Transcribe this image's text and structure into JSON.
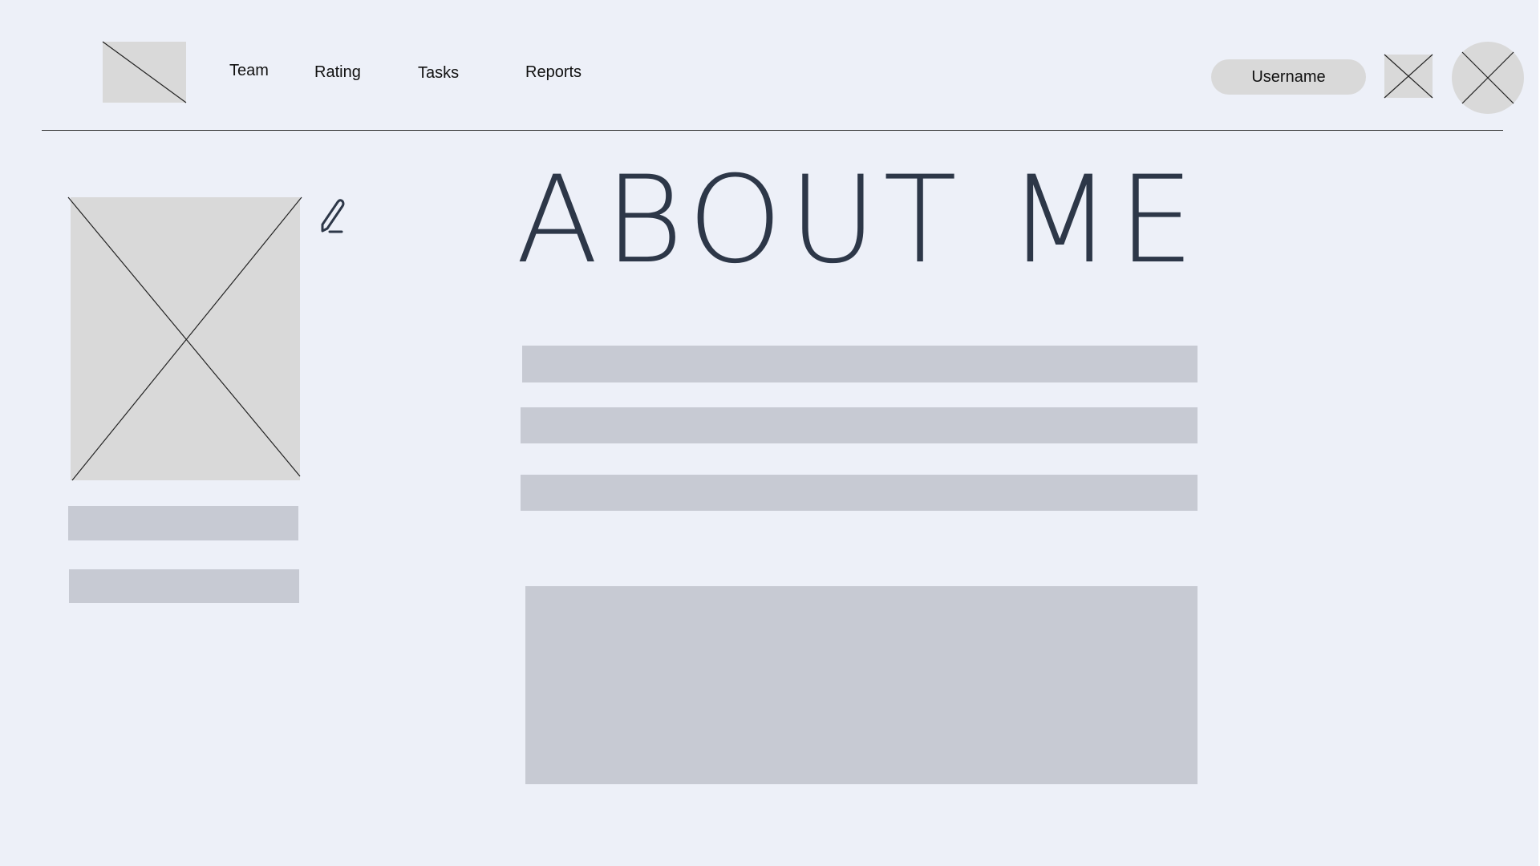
{
  "header": {
    "nav_items": [
      {
        "label": "Team"
      },
      {
        "label": "Rating"
      },
      {
        "label": "Tasks"
      },
      {
        "label": "Reports"
      }
    ],
    "username": "Username"
  },
  "main": {
    "title": "ABOUT ME"
  },
  "icons": {
    "logo": "image-placeholder",
    "notification": "image-placeholder",
    "avatar": "image-placeholder",
    "profile_photo": "image-placeholder",
    "edit": "pencil-icon"
  },
  "colors": {
    "background": "#edf0f8",
    "placeholder": "#d9d9d9",
    "text_bar": "#c7cad3",
    "title": "#2d3748"
  }
}
